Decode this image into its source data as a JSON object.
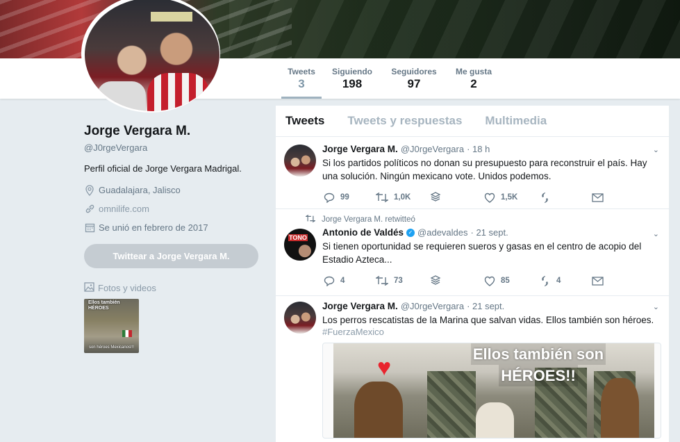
{
  "nav": {
    "items": [
      {
        "label": "Tweets",
        "value": "3"
      },
      {
        "label": "Siguiendo",
        "value": "198"
      },
      {
        "label": "Seguidores",
        "value": "97"
      },
      {
        "label": "Me gusta",
        "value": "2"
      }
    ]
  },
  "profile": {
    "name": "Jorge Vergara M.",
    "handle": "@J0rgeVergara",
    "bio": "Perfil oficial de Jorge Vergara Madrigal.",
    "location": "Guadalajara, Jalisco",
    "website": "omnilife.com",
    "joined": "Se unió en febrero de 2017",
    "tweet_button": "Twittear a Jorge Vergara M.",
    "photos_label": "Fotos y videos",
    "thumb_line1": "Ellos también",
    "thumb_line2": "HÉROES",
    "thumb_caption": "son héroes Mexicanos!!!"
  },
  "timeline": {
    "tabs": [
      "Tweets",
      "Tweets y respuestas",
      "Multimedia"
    ],
    "tweets": [
      {
        "name": "Jorge Vergara M.",
        "handle": "@J0rgeVergara",
        "time": "· 18 h",
        "text": "Si los partidos políticos no donan su presupuesto para reconstruir el país. Hay una solución. Ningún mexicano vote. Unidos podemos.",
        "replies": "99",
        "retweets": "1,0K",
        "likes": "1,5K"
      },
      {
        "retweet_note": "Jorge Vergara M. retwitteó",
        "avatar_text": "TONO",
        "name": "Antonio de Valdés",
        "handle": "@adevaldes",
        "time": "· 21 sept.",
        "text": "Si tienen oportunidad se requieren sueros y gasas en el centro de acopio del Estadio Azteca...",
        "replies": "4",
        "retweets": "73",
        "likes": "85",
        "extra": "4"
      },
      {
        "name": "Jorge Vergara M.",
        "handle": "@J0rgeVergara",
        "time": "· 21 sept.",
        "text": "Los perros rescatistas de la Marina que salvan vidas. Ellos también son héroes.",
        "hashtag": "#FuerzaMexico",
        "media_line1": "Ellos también son",
        "media_line2": "HÉROES!!"
      }
    ]
  },
  "colors": {
    "background": "#e6ecf0",
    "accent_muted": "#7f97a8",
    "button_disabled": "#c5ccd2",
    "verified": "#1da1f2"
  }
}
